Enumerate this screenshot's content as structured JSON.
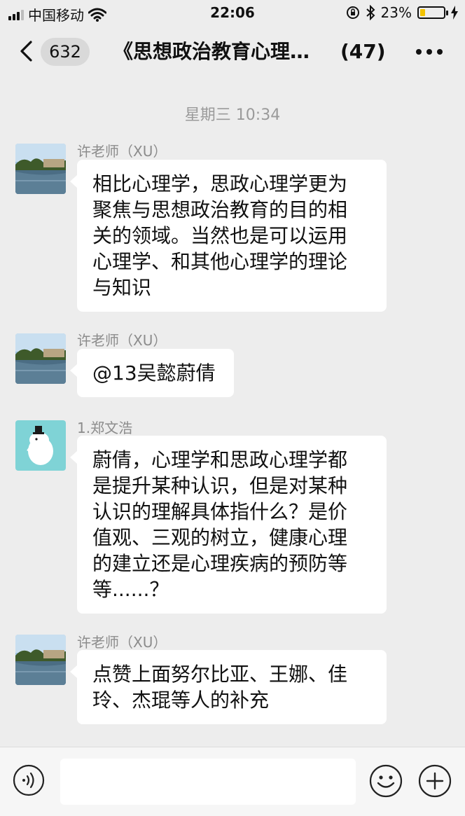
{
  "status_bar": {
    "carrier": "中国移动",
    "time": "22:06",
    "battery_percent": "23%",
    "battery_level": 0.23,
    "icons": [
      "signal-icon",
      "wifi-icon",
      "orientation-lock-icon",
      "bluetooth-icon",
      "battery-icon",
      "charging-icon"
    ]
  },
  "nav": {
    "unread_count": "632",
    "title": "《思想政治教育心理…",
    "member_count": "(47)"
  },
  "chat": {
    "timestamp": "星期三 10:34",
    "messages": [
      {
        "sender": "许老师（XU）",
        "lines": [
          "相比心理学，思政心理学更为",
          "聚焦与思想政治教育的目的相",
          "关的领域。当然也是可以运用",
          "心理学、和其他心理学的理论",
          "与知识"
        ]
      },
      {
        "sender": "许老师（XU）",
        "lines": [
          "@13吴懿蔚倩"
        ]
      },
      {
        "sender": "1.郑文浩",
        "lines": [
          "蔚倩，心理学和思政心理学都",
          "是提升某种认识，但是对某种",
          "认识的理解具体指什么？是价",
          "值观、三观的树立，健康心理",
          "的建立还是心理疾病的预防等",
          "等......？"
        ]
      },
      {
        "sender": "许老师（XU）",
        "lines": [
          "点赞上面努尔比亚、王娜、佳",
          "玲、杰琨等人的补充"
        ]
      }
    ]
  },
  "input_bar": {
    "text_value": "",
    "icons": [
      "voice-icon",
      "emoji-icon",
      "plus-icon"
    ]
  },
  "colors": {
    "background": "#ededed",
    "bubble": "#ffffff",
    "battery_fill": "#f2c200",
    "secondary_text": "#8c8c8c"
  }
}
